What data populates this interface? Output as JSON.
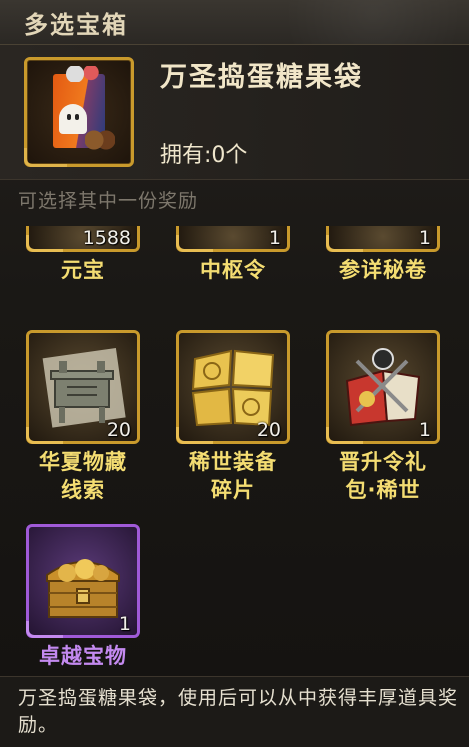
{
  "window": {
    "title": "多选宝箱"
  },
  "item": {
    "name": "万圣捣蛋糖果袋",
    "owned_label": "拥有:0个",
    "icon": "halloween-candy-bag-icon"
  },
  "choose_hint": "可选择其中一份奖励",
  "rewards_row1": [
    {
      "label": "元宝",
      "count": "1588"
    },
    {
      "label": "中枢令",
      "count": "1"
    },
    {
      "label": "参详秘卷",
      "count": "1"
    }
  ],
  "rewards_row2": [
    {
      "label_line1": "华夏物藏",
      "label_line2": "线索",
      "count": "20",
      "icon": "bronze-ding-icon"
    },
    {
      "label_line1": "稀世装备",
      "label_line2": "碎片",
      "count": "20",
      "icon": "golden-fragments-icon"
    },
    {
      "label_line1": "晋升令礼",
      "label_line2": "包·稀世",
      "count": "1",
      "icon": "promotion-pack-icon"
    }
  ],
  "rewards_row3": [
    {
      "label": "卓越宝物",
      "count": "1",
      "icon": "treasure-chest-icon",
      "rarity_color": "#c48af0"
    }
  ],
  "description": "万圣捣蛋糖果袋，使用后可以从中获得丰厚道具奖励。",
  "colors": {
    "gold_border": "#c99a2c",
    "gold_label": "#f4dd72",
    "purple": "#c48af0"
  }
}
